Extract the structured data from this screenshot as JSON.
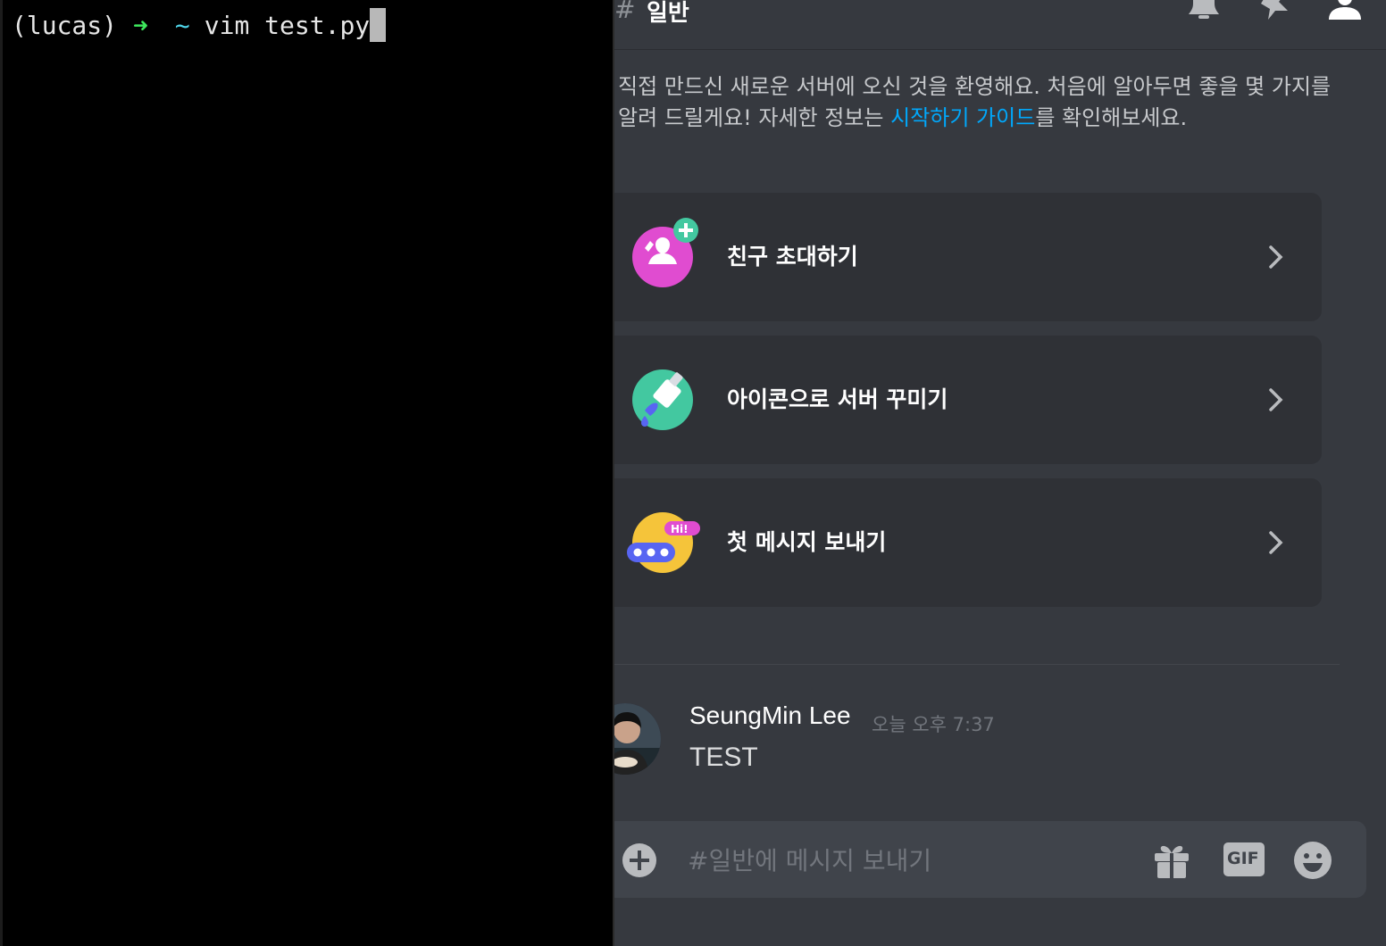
{
  "terminal": {
    "venv": "(lucas)",
    "arrow": "➜",
    "tilde": "~",
    "command": "vim test.py"
  },
  "discord": {
    "channel": {
      "hash": "#",
      "name": "일반"
    },
    "header_icons": [
      "bell-icon",
      "pin-icon",
      "members-icon"
    ],
    "welcome": {
      "text_before": "직접 만드신 새로운 서버에 오신 것을 환영해요. 처음에 알아두면 좋을 몇 가지를 알려    드릴게요! 자세한 정보는 ",
      "link": "시작하기 가이드",
      "text_after": "를 확인해보세요."
    },
    "cards": [
      {
        "label": "친구 초대하기",
        "icon": "invite-friend-icon"
      },
      {
        "label": "아이콘으로 서버 꾸미기",
        "icon": "paint-brush-icon"
      },
      {
        "label": "첫 메시지 보내기",
        "icon": "hi-message-icon"
      }
    ],
    "message": {
      "author": "SeungMin Lee",
      "timestamp": "오늘 오후 7:37",
      "text": "TEST"
    },
    "composer": {
      "placeholder": "#일반에 메시지 보내기",
      "gif_label": "GIF"
    },
    "colors": {
      "background": "#36393f",
      "card": "#2f3136",
      "link": "#00a8fc",
      "terminal_arrow": "#3ee85d",
      "terminal_tilde": "#4fd6ea"
    }
  }
}
